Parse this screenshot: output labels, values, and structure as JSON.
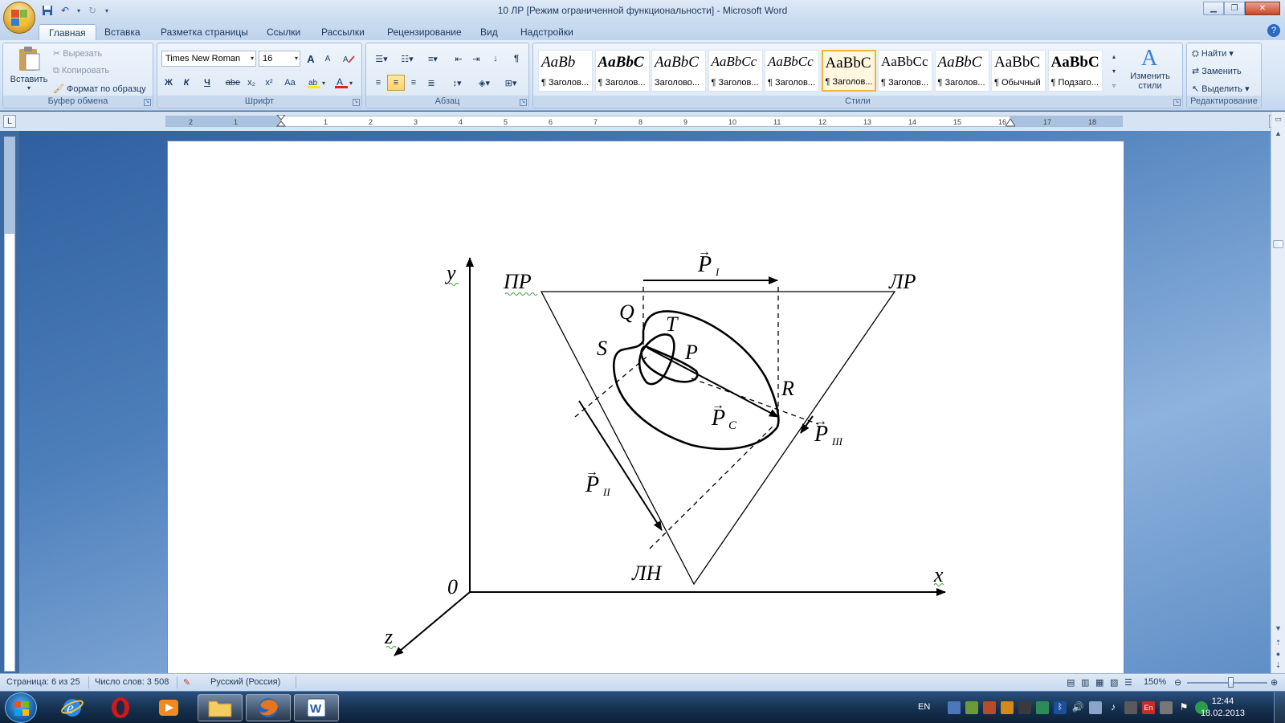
{
  "window": {
    "title": "10 ЛР [Режим ограниченной функциональности] - Microsoft Word"
  },
  "tabs": [
    "Главная",
    "Вставка",
    "Разметка страницы",
    "Ссылки",
    "Рассылки",
    "Рецензирование",
    "Вид",
    "Надстройки"
  ],
  "clipboard": {
    "paste": "Вставить",
    "cut": "Вырезать",
    "copy": "Копировать",
    "format_painter": "Формат по образцу",
    "label": "Буфер обмена"
  },
  "font": {
    "name": "Times New Roman",
    "size": "16",
    "label": "Шрифт",
    "bold": "Ж",
    "italic": "К",
    "underline": "Ч",
    "strike": "abe",
    "sub": "x₂",
    "sup": "x²",
    "case": "Aa",
    "grow": "A",
    "shrink": "A"
  },
  "paragraph": {
    "label": "Абзац"
  },
  "styles": {
    "label": "Стили",
    "items": [
      {
        "sample": "AaBb",
        "name": "¶ Заголов..."
      },
      {
        "sample": "AaBbC",
        "name": "¶ Заголов..."
      },
      {
        "sample": "AaBbC",
        "name": "Заголово..."
      },
      {
        "sample": "AaBbCc",
        "name": "¶ Заголов..."
      },
      {
        "sample": "AaBbCc",
        "name": "¶ Заголов..."
      },
      {
        "sample": "AaBbC",
        "name": "¶ Заголов..."
      },
      {
        "sample": "AaBbCc",
        "name": "¶ Заголов..."
      },
      {
        "sample": "AaBbC",
        "name": "¶ Заголов..."
      },
      {
        "sample": "AaBbC",
        "name": "¶ Обычный"
      },
      {
        "sample": "AaBbC",
        "name": "¶ Подзаго..."
      }
    ],
    "change": "Изменить стили"
  },
  "editing": {
    "find": "Найти",
    "replace": "Заменить",
    "select": "Выделить",
    "label": "Редактирование"
  },
  "ruler": {
    "ticks": [
      "2",
      "1",
      "1",
      "2",
      "3",
      "4",
      "5",
      "6",
      "7",
      "8",
      "9",
      "10",
      "11",
      "12",
      "13",
      "14",
      "15",
      "16",
      "17",
      "18"
    ]
  },
  "diagram": {
    "labels": {
      "y": "y",
      "x": "x",
      "z": "z",
      "origin": "0",
      "pr": "ПР",
      "lr": "ЛР",
      "ln": "ЛН",
      "q": "Q",
      "t": "T",
      "s": "S",
      "p": "P",
      "r": "R",
      "p1": "P",
      "p1_sub": "I",
      "p2": "P",
      "p2_sub": "II",
      "p3": "P",
      "p3_sub": "III",
      "pc": "P",
      "pc_sub": "C"
    }
  },
  "status": {
    "page": "Страница: 6 из 25",
    "words": "Число слов: 3 508",
    "language": "Русский (Россия)",
    "zoom": "150%",
    "zoom_percent": 150
  },
  "taskbar": {
    "lang": "EN",
    "time": "12:44",
    "date": "18.02.2013"
  }
}
